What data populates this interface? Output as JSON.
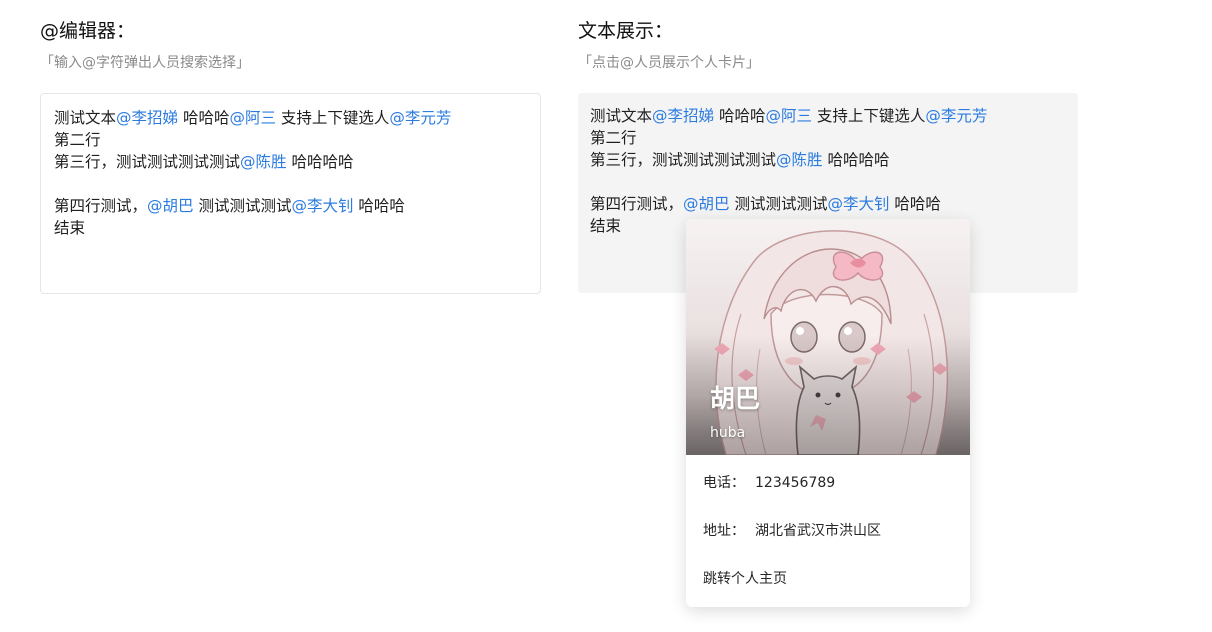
{
  "editor": {
    "title": "@编辑器：",
    "description": "「输入@字符弹出人员搜索选择」",
    "lines": [
      [
        {
          "text": "测试文本"
        },
        {
          "text": "@李招娣",
          "mention": true
        },
        {
          "text": " 哈哈哈"
        },
        {
          "text": "@阿三",
          "mention": true
        },
        {
          "text": " 支持上下键选人"
        },
        {
          "text": "@李元芳",
          "mention": true
        }
      ],
      [
        {
          "text": "第二行"
        }
      ],
      [
        {
          "text": "第三行，测试测试测试测试"
        },
        {
          "text": "@陈胜",
          "mention": true
        },
        {
          "text": " 哈哈哈哈"
        }
      ],
      [],
      [
        {
          "text": "第四行测试，"
        },
        {
          "text": "@胡巴",
          "mention": true
        },
        {
          "text": " 测试测试测试"
        },
        {
          "text": "@李大钊",
          "mention": true
        },
        {
          "text": " 哈哈哈"
        }
      ],
      [
        {
          "text": "结束"
        }
      ]
    ]
  },
  "display": {
    "title": "文本展示：",
    "description": "「点击@人员展示个人卡片」",
    "lines": [
      [
        {
          "text": "测试文本"
        },
        {
          "text": "@李招娣",
          "mention": true
        },
        {
          "text": " 哈哈哈"
        },
        {
          "text": "@阿三",
          "mention": true
        },
        {
          "text": " 支持上下键选人"
        },
        {
          "text": "@李元芳",
          "mention": true
        }
      ],
      [
        {
          "text": "第二行"
        }
      ],
      [
        {
          "text": "第三行，测试测试测试测试"
        },
        {
          "text": "@陈胜",
          "mention": true
        },
        {
          "text": " 哈哈哈哈"
        }
      ],
      [],
      [
        {
          "text": "第四行测试，"
        },
        {
          "text": "@胡巴",
          "mention": true
        },
        {
          "text": " 测试测试测试"
        },
        {
          "text": "@李大钊",
          "mention": true
        },
        {
          "text": " 哈哈哈"
        }
      ],
      [
        {
          "text": "结束"
        }
      ]
    ]
  },
  "profile_card": {
    "name": "胡巴",
    "username": "huba",
    "phone_label": "电话：",
    "phone": "123456789",
    "address_label": "地址：",
    "address": "湖北省武汉市洪山区",
    "profile_link": "跳转个人主页"
  },
  "colors": {
    "mention": "#2b7be0",
    "display_background": "#f4f4f4",
    "editor_border": "#e6e6e6"
  }
}
